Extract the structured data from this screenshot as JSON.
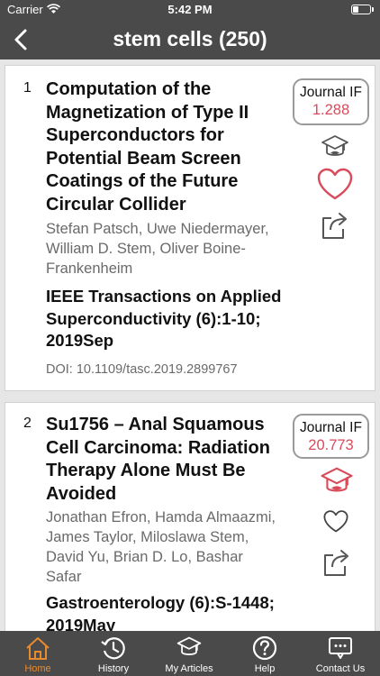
{
  "status_bar": {
    "carrier": "Carrier",
    "time": "5:42 PM"
  },
  "nav": {
    "title": "stem cells (250)"
  },
  "articles": [
    {
      "number": "1",
      "title": "Computation of the Magnetization of Type II Superconductors for Potential Beam Screen Coatings of the Future Circular Collider",
      "authors": "Stefan Patsch, Uwe Niedermayer, William D. Stem, Oliver Boine-Frankenheim",
      "journal": "IEEE Transactions on Applied Superconductivity (6):1-10; 2019Sep",
      "doi": "DOI: 10.1109/tasc.2019.2899767",
      "if_label": "Journal IF",
      "if_value": "1.288",
      "saved": false,
      "favorited": false
    },
    {
      "number": "2",
      "title": "Su1756 – Anal Squamous Cell Carcinoma: Radiation Therapy Alone Must Be Avoided",
      "authors": "Jonathan Efron, Hamda Almaazmi, James Taylor, Miloslawa Stem, David Yu, Brian D. Lo, Bashar Safar",
      "journal": "Gastroenterology (6):S-1448; 2019May",
      "if_label": "Journal IF",
      "if_value": "20.773",
      "saved": true,
      "favorited": false
    }
  ],
  "tabs": [
    {
      "label": "Home",
      "icon": "home-icon",
      "active": true
    },
    {
      "label": "History",
      "icon": "history-icon",
      "active": false
    },
    {
      "label": "My Articles",
      "icon": "graduation-cap-icon",
      "active": false
    },
    {
      "label": "Help",
      "icon": "help-icon",
      "active": false
    },
    {
      "label": "Contact Us",
      "icon": "chat-icon",
      "active": false
    }
  ],
  "colors": {
    "bar": "#4a4a4a",
    "accent_active": "#e88a2e",
    "impact_factor": "#d94a5a",
    "background": "#e6e6e6"
  }
}
